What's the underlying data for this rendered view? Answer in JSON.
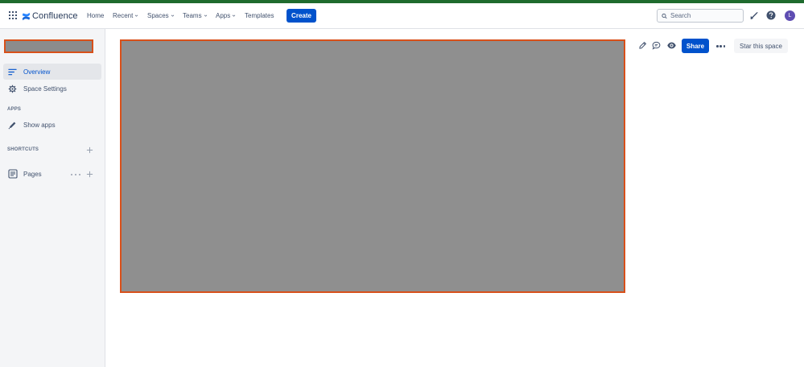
{
  "colors": {
    "top_stripe": "#1f6b2e",
    "accent": "#0052cc",
    "highlight_border": "#d8501a",
    "placeholder_fill": "#8f8f8f"
  },
  "topbar": {
    "app_name": "Confluence",
    "nav": [
      {
        "label": "Home",
        "has_dropdown": false
      },
      {
        "label": "Recent",
        "has_dropdown": true
      },
      {
        "label": "Spaces",
        "has_dropdown": true
      },
      {
        "label": "Teams",
        "has_dropdown": true
      },
      {
        "label": "Apps",
        "has_dropdown": true
      },
      {
        "label": "Templates",
        "has_dropdown": false
      }
    ],
    "create_label": "Create",
    "search": {
      "placeholder": "Search",
      "value": ""
    },
    "icons": [
      "app-switcher-icon",
      "confluence-logo-icon",
      "search-icon",
      "notifications-icon",
      "help-icon"
    ],
    "avatar_initial": "L"
  },
  "sidebar": {
    "items": [
      {
        "label": "Overview",
        "icon": "overview-icon",
        "active": true
      },
      {
        "label": "Space Settings",
        "icon": "gear-icon",
        "active": false
      }
    ],
    "apps_heading": "APPS",
    "apps_items": [
      {
        "label": "Show apps",
        "icon": "pencil-icon"
      }
    ],
    "shortcuts_heading": "SHORTCUTS",
    "pages_item": {
      "label": "Pages",
      "icon": "pages-icon"
    }
  },
  "toolbar": {
    "icons": [
      "edit-icon",
      "comment-icon",
      "watch-icon"
    ],
    "share_label": "Share",
    "star_label": "Star this space"
  }
}
